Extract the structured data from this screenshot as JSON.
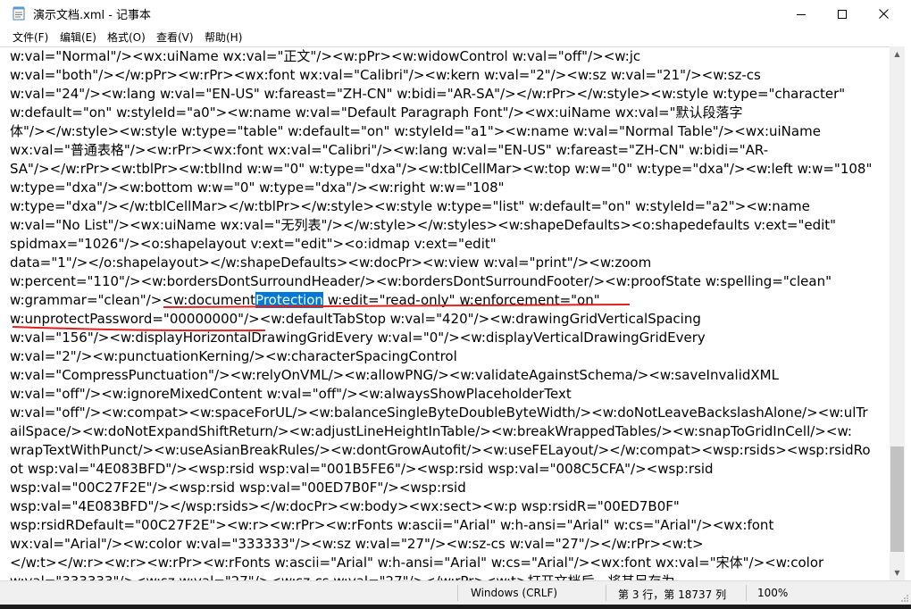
{
  "window": {
    "title": "演示文档.xml - 记事本",
    "minimize_symbol": "—",
    "maximize_symbol": "☐",
    "close_symbol": "✕",
    "icon": "notepad-icon"
  },
  "menu": [
    "文件(F)",
    "编辑(E)",
    "格式(O)",
    "查看(V)",
    "帮助(H)"
  ],
  "editor": {
    "lines": [
      "w:val=\"Normal\"/><wx:uiName wx:val=\"正文\"/><w:pPr><w:widowControl w:val=\"off\"/><w:jc",
      "w:val=\"both\"/></w:pPr><w:rPr><wx:font wx:val=\"Calibri\"/><w:kern w:val=\"2\"/><w:sz w:val=\"21\"/><w:sz-cs",
      "w:val=\"24\"/><w:lang w:val=\"EN-US\" w:fareast=\"ZH-CN\" w:bidi=\"AR-SA\"/></w:rPr></w:style><w:style w:type=\"character\"",
      "w:default=\"on\" w:styleId=\"a0\"><w:name w:val=\"Default Paragraph Font\"/><wx:uiName wx:val=\"默认段落字",
      "体\"/></w:style><w:style w:type=\"table\" w:default=\"on\" w:styleId=\"a1\"><w:name w:val=\"Normal Table\"/><wx:uiName",
      "wx:val=\"普通表格\"/><w:rPr><wx:font wx:val=\"Calibri\"/><w:lang w:val=\"EN-US\" w:fareast=\"ZH-CN\" w:bidi=\"AR-",
      "SA\"/></w:rPr><w:tblPr><w:tblInd w:w=\"0\" w:type=\"dxa\"/><w:tblCellMar><w:top w:w=\"0\" w:type=\"dxa\"/><w:left w:w=\"108\"",
      "w:type=\"dxa\"/><w:bottom w:w=\"0\" w:type=\"dxa\"/><w:right w:w=\"108\"",
      "w:type=\"dxa\"/></w:tblCellMar></w:tblPr></w:style><w:style w:type=\"list\" w:default=\"on\" w:styleId=\"a2\"><w:name",
      "w:val=\"No List\"/><wx:uiName wx:val=\"无列表\"/></w:style></w:styles><w:shapeDefaults><o:shapedefaults v:ext=\"edit\"",
      "spidmax=\"1026\"/><o:shapelayout v:ext=\"edit\"><o:idmap v:ext=\"edit\"",
      "data=\"1\"/></o:shapelayout></w:shapeDefaults><w:docPr><w:view w:val=\"print\"/><w:zoom",
      "w:percent=\"110\"/><w:bordersDontSurroundHeader/><w:bordersDontSurroundFooter/><w:proofState w:spelling=\"clean\"",
      null,
      "w:unprotectPassword=\"00000000\"/><w:defaultTabStop w:val=\"420\"/><w:drawingGridVerticalSpacing",
      "w:val=\"156\"/><w:displayHorizontalDrawingGridEvery w:val=\"0\"/><w:displayVerticalDrawingGridEvery",
      "w:val=\"2\"/><w:punctuationKerning/><w:characterSpacingControl",
      "w:val=\"CompressPunctuation\"/><w:relyOnVML/><w:allowPNG/><w:validateAgainstSchema/><w:saveInvalidXML",
      "w:val=\"off\"/><w:ignoreMixedContent w:val=\"off\"/><w:alwaysShowPlaceholderText",
      "w:val=\"off\"/><w:compat><w:spaceForUL/><w:balanceSingleByteDoubleByteWidth/><w:doNotLeaveBackslashAlone/><w:ulTr",
      "ailSpace/><w:doNotExpandShiftReturn/><w:adjustLineHeightInTable/><w:breakWrappedTables/><w:snapToGridInCell/><w:",
      "wrapTextWithPunct/><w:useAsianBreakRules/><w:dontGrowAutofit/><w:useFELayout/></w:compat><wsp:rsids><wsp:rsidRo",
      "ot wsp:val=\"4E083BFD\"/><wsp:rsid wsp:val=\"001B5FE6\"/><wsp:rsid wsp:val=\"008C5CFA\"/><wsp:rsid",
      "wsp:val=\"00C27F2E\"/><wsp:rsid wsp:val=\"00ED7B0F\"/><wsp:rsid",
      "wsp:val=\"4E083BFD\"/></wsp:rsids></w:docPr><w:body><wx:sect><w:p wsp:rsidR=\"00ED7B0F\"",
      "wsp:rsidRDefault=\"00C27F2E\"><w:r><w:rPr><w:rFonts w:ascii=\"Arial\" w:h-ansi=\"Arial\" w:cs=\"Arial\"/><wx:font",
      "wx:val=\"Arial\"/><w:color w:val=\"333333\"/><w:sz w:val=\"27\"/><w:sz-cs w:val=\"27\"/></w:rPr><w:t>",
      "</w:t></w:r><w:r><w:rPr><w:rFonts w:ascii=\"Arial\" w:h-ansi=\"Arial\" w:cs=\"Arial\"/><wx:font wx:val=\"宋体\"/><w:color",
      "w:val=\"333333\"/><w:sz w:val=\"27\"/><w:sz-cs w:val=\"27\"/></w:rPr><w:t>打开文档后，将其另存为"
    ],
    "line14_before": "w:grammar=\"clean\"/><w:document",
    "line14_selected": "Protection",
    "line14_after": " w:edit=\"read-only\" w:enforcement=\"on\"",
    "annotation_color": "#e02020",
    "selection_color": "#0078d7"
  },
  "status": {
    "line_ending": "Windows (CRLF)",
    "position": "第 3 行，第 18737 列",
    "zoom": "100%"
  }
}
